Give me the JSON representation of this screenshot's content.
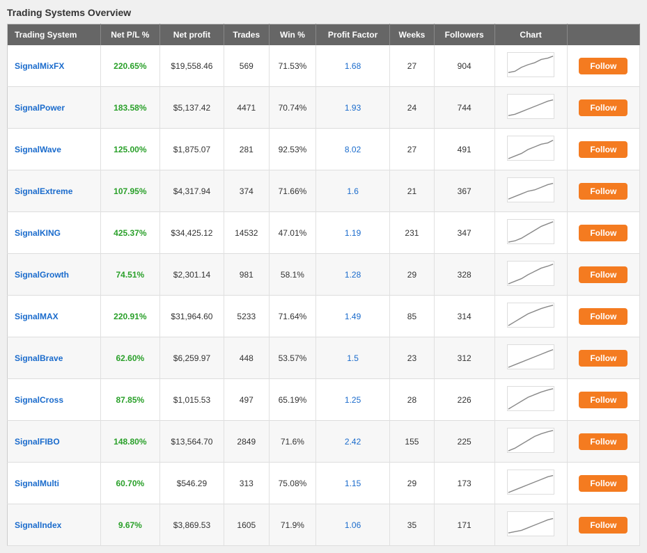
{
  "page": {
    "title": "Trading Systems Overview"
  },
  "table": {
    "headers": [
      "Trading System",
      "Net P/L %",
      "Net profit",
      "Trades",
      "Win %",
      "Profit Factor",
      "Weeks",
      "Followers",
      "Chart",
      ""
    ],
    "rows": [
      {
        "name": "SignalMixFX",
        "netpl": "220.65%",
        "profit": "$19,558.46",
        "trades": "569",
        "win": "71.53%",
        "pf": "1.68",
        "weeks": "27",
        "followers": "904",
        "chartPoints": "0,30 10,28 20,22 30,18 40,15 50,10 60,8 68,5",
        "follow": "Follow"
      },
      {
        "name": "SignalPower",
        "netpl": "183.58%",
        "profit": "$5,137.42",
        "trades": "4471",
        "win": "70.74%",
        "pf": "1.93",
        "weeks": "24",
        "followers": "744",
        "chartPoints": "0,32 10,30 20,26 30,22 40,18 50,14 60,10 68,8",
        "follow": "Follow"
      },
      {
        "name": "SignalWave",
        "netpl": "125.00%",
        "profit": "$1,875.07",
        "trades": "281",
        "win": "92.53%",
        "pf": "8.02",
        "weeks": "27",
        "followers": "491",
        "chartPoints": "0,34 10,30 20,26 30,20 40,16 50,12 60,10 68,6",
        "follow": "Follow"
      },
      {
        "name": "SignalExtreme",
        "netpl": "107.95%",
        "profit": "$4,317.94",
        "trades": "374",
        "win": "71.66%",
        "pf": "1.6",
        "weeks": "21",
        "followers": "367",
        "chartPoints": "0,32 10,28 20,24 30,20 40,18 50,14 60,10 68,8",
        "follow": "Follow"
      },
      {
        "name": "SignalKING",
        "netpl": "425.37%",
        "profit": "$34,425.12",
        "trades": "14532",
        "win": "47.01%",
        "pf": "1.19",
        "weeks": "231",
        "followers": "347",
        "chartPoints": "0,34 10,32 20,28 30,22 40,16 50,10 60,6 68,3",
        "follow": "Follow"
      },
      {
        "name": "SignalGrowth",
        "netpl": "74.51%",
        "profit": "$2,301.14",
        "trades": "981",
        "win": "58.1%",
        "pf": "1.28",
        "weeks": "29",
        "followers": "328",
        "chartPoints": "0,34 10,30 20,26 30,20 40,15 50,10 60,7 68,4",
        "follow": "Follow"
      },
      {
        "name": "SignalMAX",
        "netpl": "220.91%",
        "profit": "$31,964.60",
        "trades": "5233",
        "win": "71.64%",
        "pf": "1.49",
        "weeks": "85",
        "followers": "314",
        "chartPoints": "0,34 10,28 20,22 30,16 40,12 50,8 60,5 68,3",
        "follow": "Follow"
      },
      {
        "name": "SignalBrave",
        "netpl": "62.60%",
        "profit": "$6,259.97",
        "trades": "448",
        "win": "53.57%",
        "pf": "1.5",
        "weeks": "23",
        "followers": "312",
        "chartPoints": "0,34 10,30 20,26 30,22 40,18 50,14 60,10 68,7",
        "follow": "Follow"
      },
      {
        "name": "SignalCross",
        "netpl": "87.85%",
        "profit": "$1,015.53",
        "trades": "497",
        "win": "65.19%",
        "pf": "1.25",
        "weeks": "28",
        "followers": "226",
        "chartPoints": "0,34 10,28 20,22 30,16 40,12 50,8 60,5 68,3",
        "follow": "Follow"
      },
      {
        "name": "SignalFIBO",
        "netpl": "148.80%",
        "profit": "$13,564.70",
        "trades": "2849",
        "win": "71.6%",
        "pf": "2.42",
        "weeks": "155",
        "followers": "225",
        "chartPoints": "0,34 10,30 20,24 30,18 40,12 50,8 60,5 68,3",
        "follow": "Follow"
      },
      {
        "name": "SignalMulti",
        "netpl": "60.70%",
        "profit": "$546.29",
        "trades": "313",
        "win": "75.08%",
        "pf": "1.15",
        "weeks": "29",
        "followers": "173",
        "chartPoints": "0,34 10,30 20,26 30,22 40,18 50,14 60,10 68,8",
        "follow": "Follow"
      },
      {
        "name": "SignalIndex",
        "netpl": "9.67%",
        "profit": "$3,869.53",
        "trades": "1605",
        "win": "71.9%",
        "pf": "1.06",
        "weeks": "35",
        "followers": "171",
        "chartPoints": "0,32 10,30 20,28 30,24 40,20 50,16 60,12 68,10",
        "follow": "Follow"
      }
    ]
  }
}
